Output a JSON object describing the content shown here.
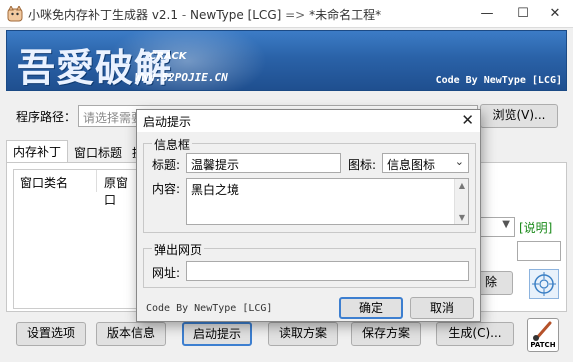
{
  "window": {
    "app_name": "小咪免内存补丁生成器 v2.1",
    "sep1": "-",
    "author": "NewType [LCG]",
    "sep2": "=>",
    "project": "*未命名工程*",
    "controls": {
      "minimize": "—",
      "maximize": "☐",
      "close": "✕"
    }
  },
  "banner": {
    "logo": "吾愛破解",
    "crack": "CRACK",
    "url": "WWW.52POJIE.CN",
    "code": "Code By NewType [LCG]"
  },
  "path": {
    "label": "程序路径：",
    "placeholder": "请选择需要",
    "browse_label": "浏览(V)..."
  },
  "tabs": [
    {
      "label": "内存补丁"
    },
    {
      "label": "窗口标题"
    },
    {
      "label": "提"
    }
  ],
  "list": {
    "columns": [
      "窗口类名",
      "原窗口"
    ]
  },
  "right_panel": {
    "help_label": "[说明]",
    "delete_label": "除"
  },
  "bottom_buttons": {
    "settings": "设置选项",
    "version": "版本信息",
    "startup": "启动提示",
    "load": "读取方案",
    "save": "保存方案",
    "generate": "生成(C)..."
  },
  "patch_label": "PATCH",
  "dialog": {
    "title": "启动提示",
    "close": "✕",
    "info_group": "信息框",
    "title_label": "标题:",
    "title_value": "温馨提示",
    "icon_label": "图标:",
    "icon_value": "信息图标",
    "content_label": "内容:",
    "content_value": "黑白之境",
    "popup_group": "弹出网页",
    "url_label": "网址:",
    "url_value": "",
    "footer": "Code By NewType [LCG]",
    "ok_label": "确定",
    "cancel_label": "取消"
  },
  "colors": {
    "banner": "#2a62a8",
    "help_link": "#1a8a1a",
    "focus_border": "#3d7fd0"
  }
}
